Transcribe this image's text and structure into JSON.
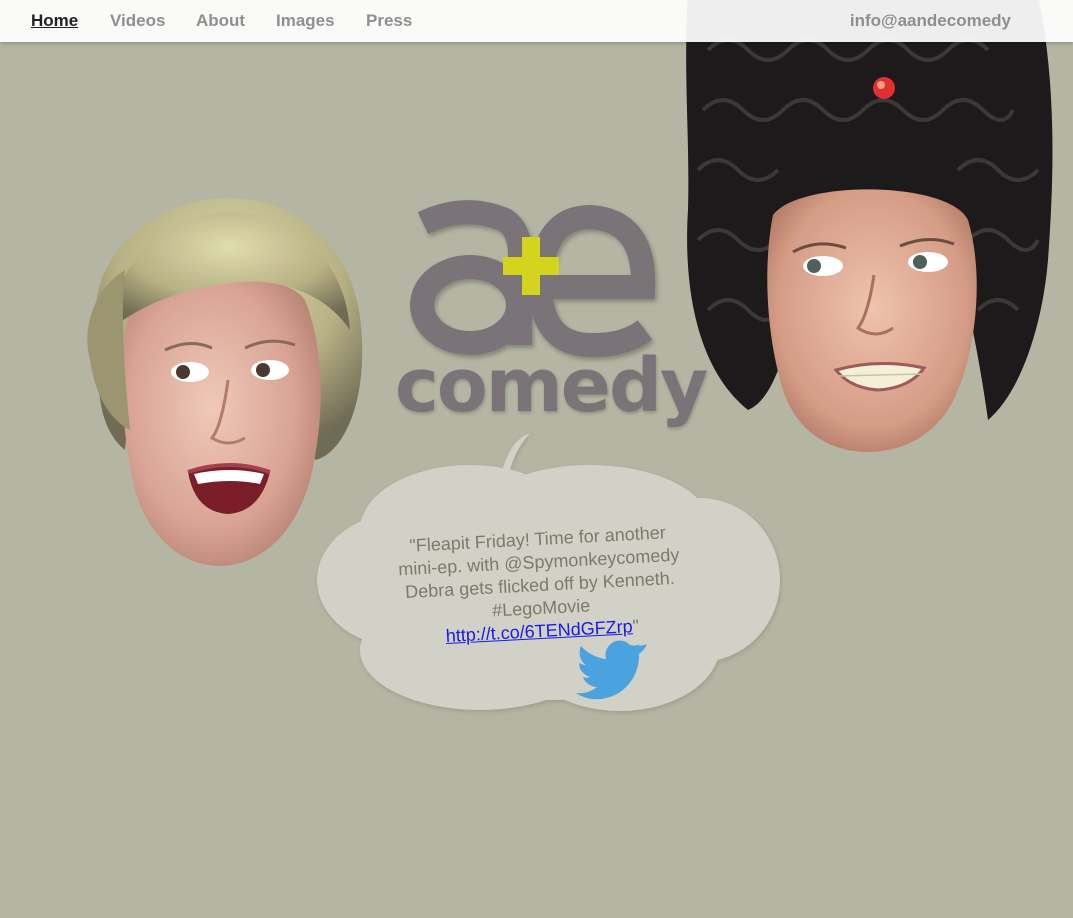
{
  "nav": {
    "items": [
      {
        "label": "Home",
        "active": true
      },
      {
        "label": "Videos"
      },
      {
        "label": "About"
      },
      {
        "label": "Images"
      },
      {
        "label": "Press"
      }
    ],
    "email": "info@aandecomedy"
  },
  "logo": {
    "glyphs": "a+e",
    "word": "comedy"
  },
  "tweet": {
    "lines": [
      "\"Fleapit Friday! Time for another",
      "mini-ep. with @Spymonkeycomedy",
      "Debra gets flicked off by Kenneth.",
      "#LegoMovie"
    ],
    "link": "http://t.co/6TENdGFZrp",
    "close_quote": "\""
  },
  "colors": {
    "background": "#b5b5a3",
    "bubble": "#d1d1c7",
    "logo_gray": "#7a7378",
    "logo_plus": "#d4d41e",
    "twitter_blue": "#4aa3df"
  },
  "icons": {
    "bird": "twitter-bird-icon"
  }
}
